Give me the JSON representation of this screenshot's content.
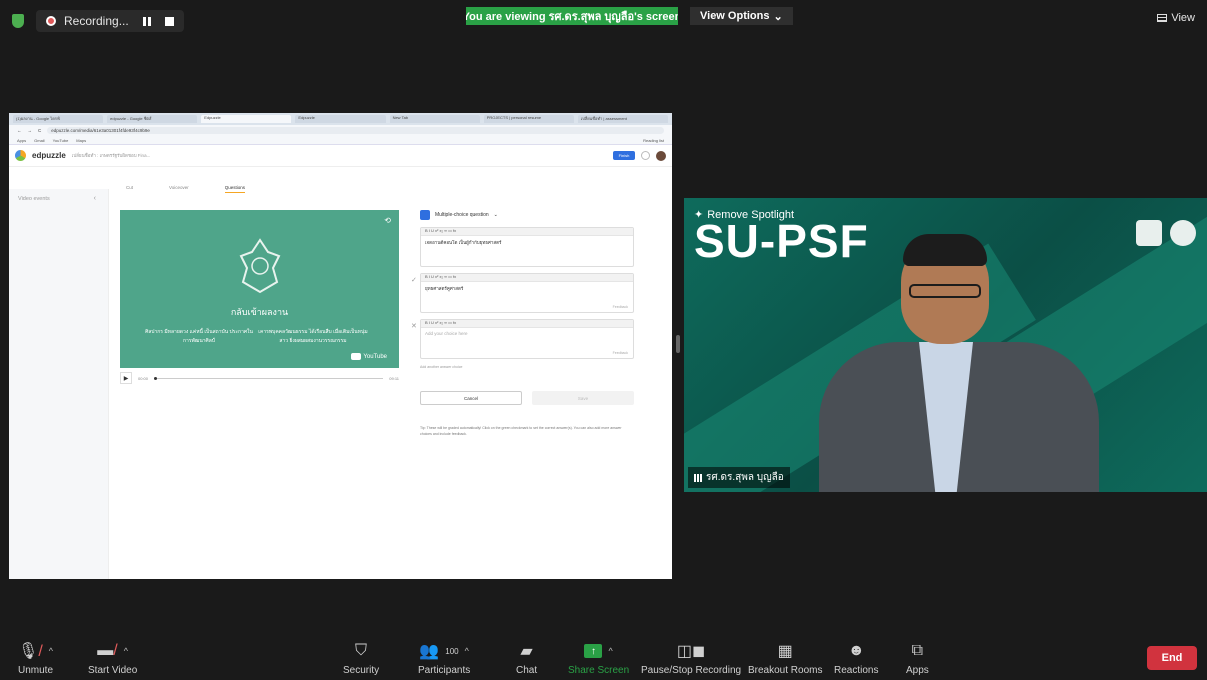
{
  "topbar": {
    "recording_label": "Recording...",
    "viewing_banner": "You are viewing รศ.ดร.สุพล บุญลือ's screen",
    "view_options_label": "View Options",
    "view_label": "View"
  },
  "shared_screen": {
    "browser_tabs": [
      "(1)ผลงาน - Google ไดรฟ์",
      "edpuzzle - Google ชีตส์",
      "Edpuzzle",
      "Edpuzzle",
      "New Tab",
      "PROJECTS | personal resume",
      "เปลี่ยนชื่อทำ | assessment"
    ],
    "url": "edpuzzle.com/media/61e3a01301f4fde93f4c9b9e",
    "bookmarks": [
      "Apps",
      "Gmail",
      "YouTube",
      "Maps"
    ],
    "reading_list": "Reading list",
    "edpuzzle": {
      "brand": "edpuzzle",
      "project_title": "เปลี่ยนชื่อทำ : เกษตรรัฐรับผิดชอบ Fina...",
      "finish_label": "Finish",
      "sidebar_label": "Video events",
      "tabs": [
        "Cut",
        "Voiceover",
        "Questions"
      ],
      "video_title": "กลับเข้าผลงาน",
      "video_left_text": "ศิลปากร มีหลายดวง แค่หนี้ เป็นสถาบัน ประกาศในการพัฒนาศิลป์",
      "video_right_text": "เคารพบุคคลวัฒนธรรม ได้เรือนสืบ เมื่อเติมเป็นหนุ่มสาว ยิ่งผสมผสมงานวรรณกรรม",
      "youtube_label": "YouTube",
      "time_start": "00:00",
      "time_end": "09:11",
      "question_type": "Multiple-choice question",
      "question_text": "เจดอานดีคอนโด เป็นผู้กำกับยุทธศาสตร์",
      "answer_1": "ยุทธศาสตร์คูศาสตร์",
      "answer_2_placeholder": "Add your choice here",
      "feedback_label": "Feedback",
      "add_answer_label": "Add another answer choice",
      "cancel_label": "Cancel",
      "save_label": "Save",
      "tip": "Tip: These will be graded automatically! Click on the green checkmark to set the correct answer(s). You can also add more answer choices and include feedback."
    }
  },
  "video_tile": {
    "remove_spotlight_label": "Remove Spotlight",
    "banner_text": "SU-PSF",
    "participant_name": "รศ.ดร.สุพล บุญลือ"
  },
  "toolbar": {
    "unmute": "Unmute",
    "start_video": "Start Video",
    "security": "Security",
    "participants": "Participants",
    "participants_count": "100",
    "chat": "Chat",
    "share_screen": "Share Screen",
    "pause_stop_recording": "Pause/Stop Recording",
    "breakout_rooms": "Breakout Rooms",
    "reactions": "Reactions",
    "apps": "Apps",
    "end": "End"
  },
  "colors": {
    "share_green": "#2aa146",
    "end_red": "#d1333e",
    "tile_teal": "#0e6b5c",
    "video_green": "#4fa58a"
  }
}
